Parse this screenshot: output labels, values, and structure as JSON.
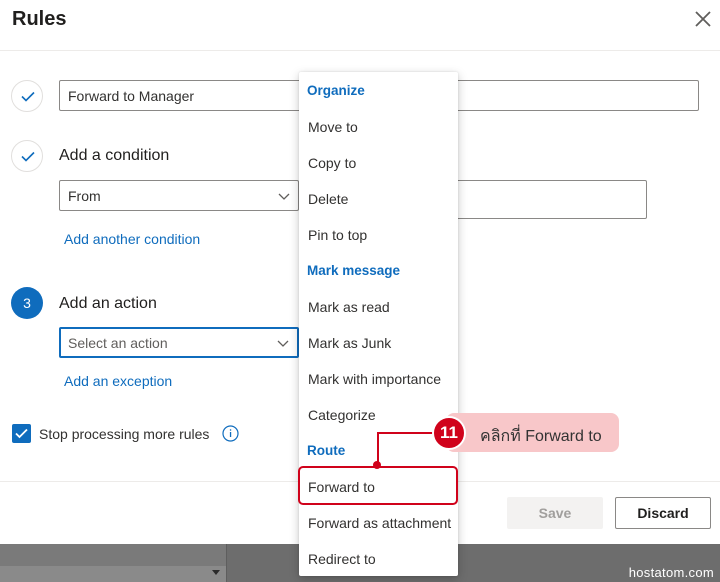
{
  "dialog": {
    "title": "Rules",
    "rule_name_value": "Forward to Manager",
    "condition": {
      "label": "Add a condition",
      "select_value": "From",
      "add_another": "Add another condition"
    },
    "action": {
      "step_number": "3",
      "label": "Add an action",
      "select_placeholder": "Select an action",
      "add_exception": "Add an exception"
    },
    "stop_processing": {
      "label": "Stop processing more rules",
      "checked": true
    },
    "buttons": {
      "save": "Save",
      "discard": "Discard"
    }
  },
  "menu": {
    "groups": [
      {
        "header": "Organize",
        "items": [
          "Move to",
          "Copy to",
          "Delete",
          "Pin to top"
        ]
      },
      {
        "header": "Mark message",
        "items": [
          "Mark as read",
          "Mark as Junk",
          "Mark with importance",
          "Categorize"
        ]
      },
      {
        "header": "Route",
        "items": [
          "Forward to",
          "Forward as attachment",
          "Redirect to"
        ]
      }
    ]
  },
  "callout": {
    "number": "11",
    "text": "คลิกที่ Forward to"
  },
  "watermark": "hostatom.com",
  "colors": {
    "accent": "#0f6cbd",
    "callout_red": "#d0021b",
    "callout_bg": "#f8c7c9"
  }
}
